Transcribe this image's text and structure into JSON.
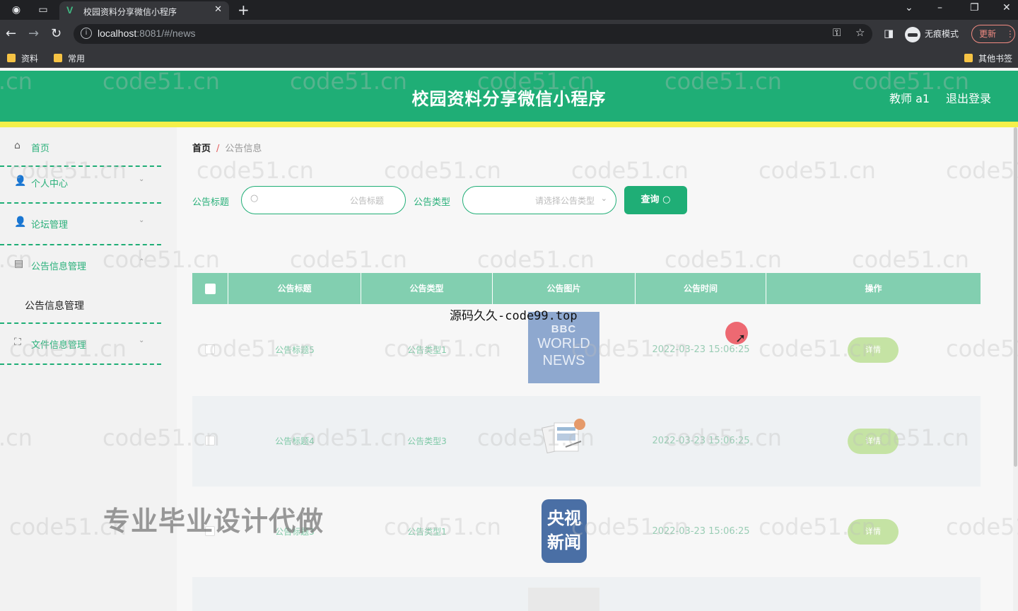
{
  "browser": {
    "tab_title": "校园资料分享微信小程序",
    "tab_logo": "V",
    "url_host": "localhost",
    "url_rest": ":8081/#/news",
    "incognito_label": "无痕模式",
    "update_label": "更新",
    "bookmarks": [
      "资料",
      "常用"
    ],
    "other_bookmarks": "其他书签"
  },
  "header": {
    "title": "校园资料分享微信小程序",
    "user": "教师 a1",
    "logout": "退出登录"
  },
  "sidebar": {
    "items": [
      {
        "label": "首页"
      },
      {
        "label": "个人中心"
      },
      {
        "label": "论坛管理"
      },
      {
        "label": "公告信息管理"
      },
      {
        "label": "文件信息管理"
      }
    ],
    "submenu": "公告信息管理"
  },
  "breadcrumb": {
    "home": "首页",
    "separator": "/",
    "current": "公告信息"
  },
  "search": {
    "title_label": "公告标题",
    "title_placeholder": "公告标题",
    "type_label": "公告类型",
    "type_placeholder": "请选择公告类型",
    "query_label": "查询"
  },
  "table": {
    "columns": [
      "公告标题",
      "公告类型",
      "公告图片",
      "公告时间",
      "操作"
    ],
    "rows": [
      {
        "title": "公告标题5",
        "type": "公告类型1",
        "image": "BBC WORLD NEWS",
        "time": "2022-03-23 15:06:25",
        "action": "详情"
      },
      {
        "title": "公告标题4",
        "type": "公告类型3",
        "image": "NEWS",
        "time": "2022-03-23 15:06:25",
        "action": "详情"
      },
      {
        "title": "公告标题3",
        "type": "公告类型1",
        "image": "央视新闻",
        "time": "2022-03-23 15:06:25",
        "action": "详情"
      }
    ]
  },
  "overlays": {
    "source_mark": "源码久久-code99.top",
    "ad_text": "专业毕业设计代做",
    "watermark": "code51.cn"
  },
  "colors": {
    "primary": "#1fae76",
    "accent_bar": "#f4f04a",
    "table_header": "#82cfb0"
  }
}
